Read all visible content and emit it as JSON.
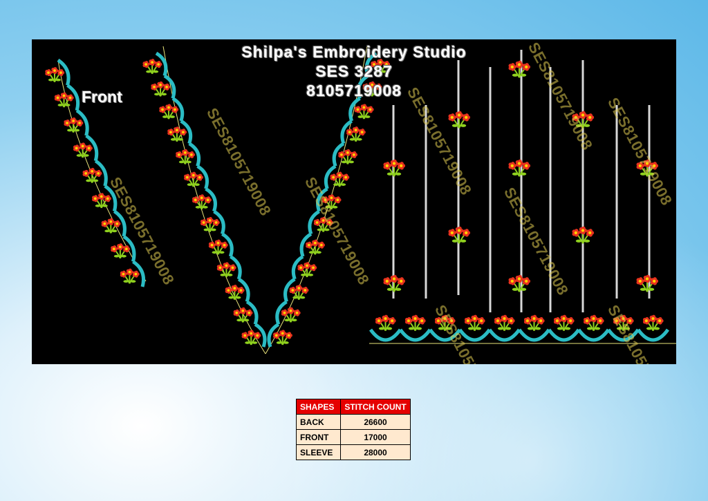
{
  "header": {
    "studio_name": "Shilpa's Embroidery Studio",
    "design_code": "SES  3287",
    "phone": "8105719008"
  },
  "labels": {
    "front": "Front"
  },
  "watermark": "SES8105719008",
  "colors": {
    "panel_bg": "#000000",
    "scallop": "#2bbcc4",
    "flower_red": "#e8321e",
    "flower_center": "#ffd400",
    "leaf": "#8fd11e",
    "vine_yellow": "#f2e21a",
    "stripe": "#d8d8d8",
    "table_header_bg": "#e50000",
    "table_row_bg": "#ffe9cf"
  },
  "stitch_table": {
    "headers": [
      "SHAPES",
      "STITCH COUNT"
    ],
    "rows": [
      {
        "shape": "BACK",
        "count": "26600"
      },
      {
        "shape": "FRONT",
        "count": "17000"
      },
      {
        "shape": "SLEEVE",
        "count": "28000"
      }
    ]
  }
}
